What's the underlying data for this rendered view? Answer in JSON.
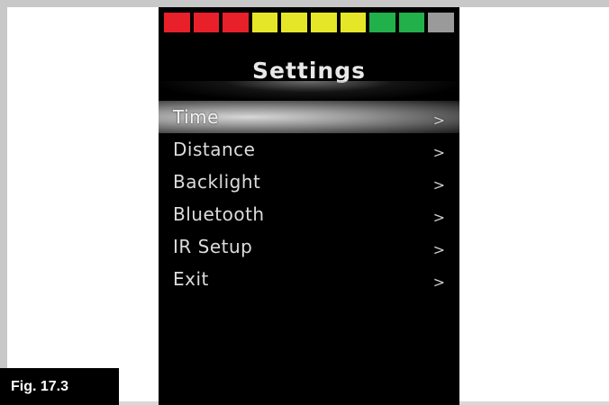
{
  "battery": {
    "segments": [
      {
        "color": "#e8202a"
      },
      {
        "color": "#e8202a"
      },
      {
        "color": "#e8202a"
      },
      {
        "color": "#e6e628"
      },
      {
        "color": "#e6e628"
      },
      {
        "color": "#e6e628"
      },
      {
        "color": "#e6e628"
      },
      {
        "color": "#22b04a"
      },
      {
        "color": "#22b04a"
      },
      {
        "color": "#9a9a9a"
      }
    ]
  },
  "screen": {
    "title": "Settings",
    "menu": [
      {
        "label": "Time",
        "chevron": ">",
        "selected": true
      },
      {
        "label": "Distance",
        "chevron": ">"
      },
      {
        "label": "Backlight",
        "chevron": ">"
      },
      {
        "label": "Bluetooth",
        "chevron": ">"
      },
      {
        "label": "IR Setup",
        "chevron": ">"
      },
      {
        "label": "Exit",
        "chevron": ">"
      }
    ]
  },
  "figure": {
    "label": "Fig. 17.3"
  }
}
